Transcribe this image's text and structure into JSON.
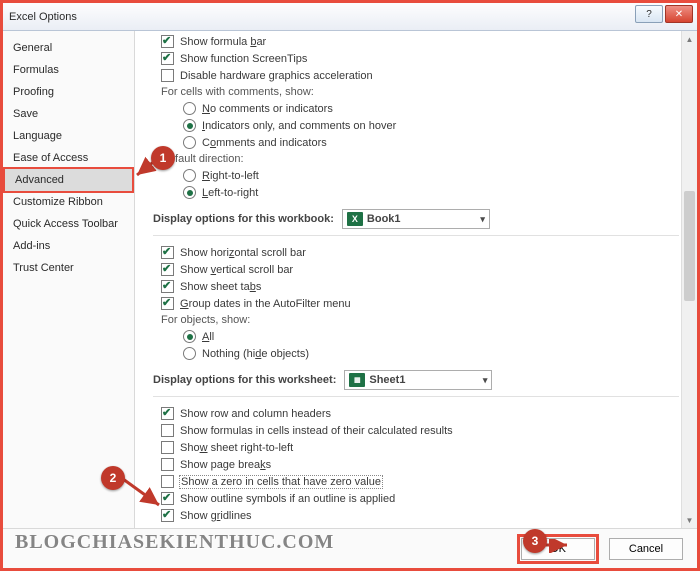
{
  "window": {
    "title": "Excel Options"
  },
  "sidebar": {
    "items": [
      {
        "label": "General"
      },
      {
        "label": "Formulas"
      },
      {
        "label": "Proofing"
      },
      {
        "label": "Save"
      },
      {
        "label": "Language"
      },
      {
        "label": "Ease of Access"
      },
      {
        "label": "Advanced",
        "selected": true
      },
      {
        "label": "Customize Ribbon"
      },
      {
        "label": "Quick Access Toolbar"
      },
      {
        "label": "Add-ins"
      },
      {
        "label": "Trust Center"
      }
    ]
  },
  "display": {
    "formula_bar": "Show formula bar",
    "screentips": "Show function ScreenTips",
    "disable_hw": "Disable hardware graphics acceleration",
    "comments_head": "For cells with comments, show:",
    "comments_none": "No comments or indicators",
    "comments_ind": "Indicators only, and comments on hover",
    "comments_both": "Comments and indicators",
    "dir_head": "Default direction:",
    "dir_rtl": "Right-to-left",
    "dir_ltr": "Left-to-right"
  },
  "workbook": {
    "head": "Display options for this workbook:",
    "combo": "Book1",
    "hscroll": "Show horizontal scroll bar",
    "vscroll": "Show vertical scroll bar",
    "tabs": "Show sheet tabs",
    "group_dates": "Group dates in the AutoFilter menu",
    "objects_head": "For objects, show:",
    "obj_all": "All",
    "obj_none": "Nothing (hide objects)"
  },
  "worksheet": {
    "head": "Display options for this worksheet:",
    "combo": "Sheet1",
    "headers": "Show row and column headers",
    "formulas": "Show formulas in cells instead of their calculated results",
    "rtl": "Show sheet right-to-left",
    "pagebreaks": "Show page breaks",
    "zero": "Show a zero in cells that have zero value",
    "outline": "Show outline symbols if an outline is applied",
    "gridlines": "Show gridlines"
  },
  "footer": {
    "ok": "OK",
    "cancel": "Cancel"
  },
  "callouts": {
    "c1": "1",
    "c2": "2",
    "c3": "3"
  },
  "watermark": "BLOGCHIASEKIENTHUC.COM"
}
